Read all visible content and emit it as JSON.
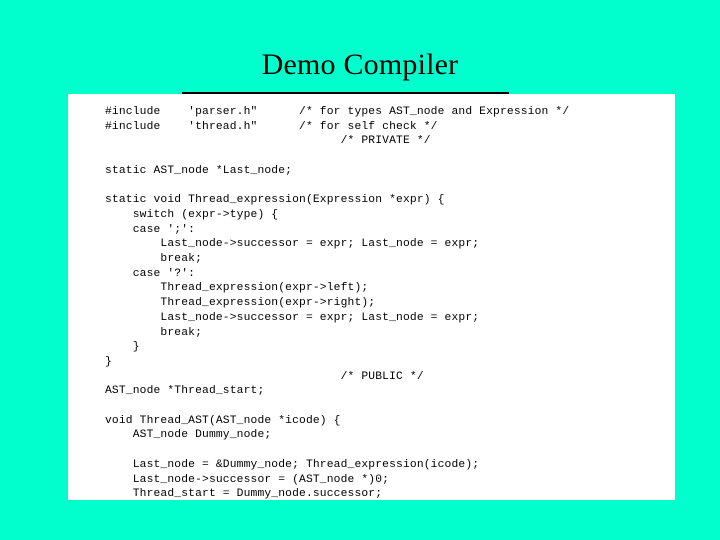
{
  "slide": {
    "title": "Demo Compiler",
    "background_color": "#00FFCC",
    "rule_color": "#000000",
    "code_panel_color": "#FFFFFF",
    "code_text_color": "#000000"
  },
  "code": {
    "language": "C",
    "lines": [
      "#include    'parser.h\"      /* for types AST_node and Expression */",
      "#include    'thread.h\"      /* for self check */",
      "                                  /* PRIVATE */",
      "",
      "static AST_node *Last_node;",
      "",
      "static void Thread_expression(Expression *expr) {",
      "    switch (expr->type) {",
      "    case ';':",
      "        Last_node->successor = expr; Last_node = expr;",
      "        break;",
      "    case '?':",
      "        Thread_expression(expr->left);",
      "        Thread_expression(expr->right);",
      "        Last_node->successor = expr; Last_node = expr;",
      "        break;",
      "    }",
      "}",
      "                                  /* PUBLIC */",
      "AST_node *Thread_start;",
      "",
      "void Thread_AST(AST_node *icode) {",
      "    AST_node Dummy_node;",
      "",
      "    Last_node = &Dummy_node; Thread_expression(icode);",
      "    Last_node->successor = (AST_node *)0;",
      "    Thread_start = Dummy_node.successor;",
      "}"
    ],
    "text": "#include    'parser.h\"      /* for types AST_node and Expression */\n#include    'thread.h\"      /* for self check */\n                                  /* PRIVATE */\n\nstatic AST_node *Last_node;\n\nstatic void Thread_expression(Expression *expr) {\n    switch (expr->type) {\n    case ';':\n        Last_node->successor = expr; Last_node = expr;\n        break;\n    case '?':\n        Thread_expression(expr->left);\n        Thread_expression(expr->right);\n        Last_node->successor = expr; Last_node = expr;\n        break;\n    }\n}\n                                  /* PUBLIC */\nAST_node *Thread_start;\n\nvoid Thread_AST(AST_node *icode) {\n    AST_node Dummy_node;\n\n    Last_node = &Dummy_node; Thread_expression(icode);\n    Last_node->successor = (AST_node *)0;\n    Thread_start = Dummy_node.successor;\n}"
  }
}
